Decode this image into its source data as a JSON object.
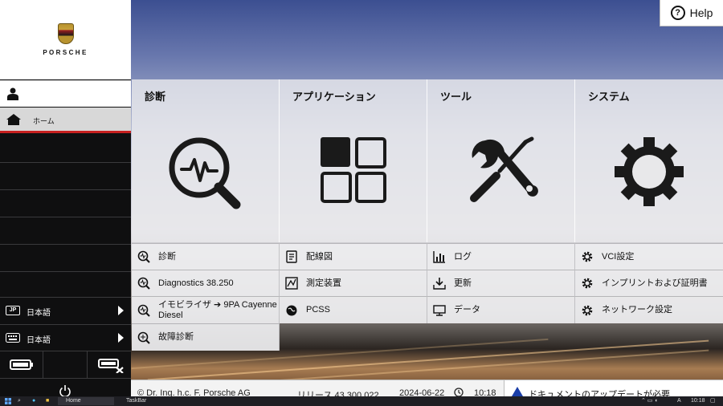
{
  "brand": {
    "wordmark": "PORSCHE"
  },
  "help": {
    "label": "Help"
  },
  "sidebar": {
    "home_label": "ホーム",
    "language_rows": [
      {
        "badge": "JP",
        "label": "日本語"
      },
      {
        "badge": "",
        "label": "日本語"
      }
    ]
  },
  "tiles": [
    {
      "title": "診断",
      "icon": "diagnosis-magnifier-icon"
    },
    {
      "title": "アプリケーション",
      "icon": "grid-apps-icon"
    },
    {
      "title": "ツール",
      "icon": "wrench-screwdriver-icon"
    },
    {
      "title": "システム",
      "icon": "gear-icon"
    }
  ],
  "items": {
    "diagnosis": [
      "診断",
      "Diagnostics 38.250",
      "イモビライザ ➔ 9PA Cayenne Diesel",
      "故障診断"
    ],
    "applications": [
      "配線図",
      "測定装置",
      "PCSS"
    ],
    "tools": [
      "ログ",
      "更新",
      "データ"
    ],
    "system": [
      "VCI設定",
      "インプリントおよび証明書",
      "ネットワーク設定"
    ]
  },
  "footer": {
    "copyright": "© Dr. Ing. h.c. F. Porsche AG",
    "release": "リリース 43.300.022",
    "date": "2024-06-22",
    "time": "10:18"
  },
  "notice": {
    "text": "ドキュメントのアップデートが必要"
  },
  "taskbar": {
    "apps": [
      "Home",
      "TaskBar"
    ],
    "clock": "10:18",
    "ime": "A"
  },
  "colors": {
    "accent_red": "#c7201f",
    "sidebar_bg": "#0f0f10",
    "warning_blue": "#1a3ea8"
  }
}
